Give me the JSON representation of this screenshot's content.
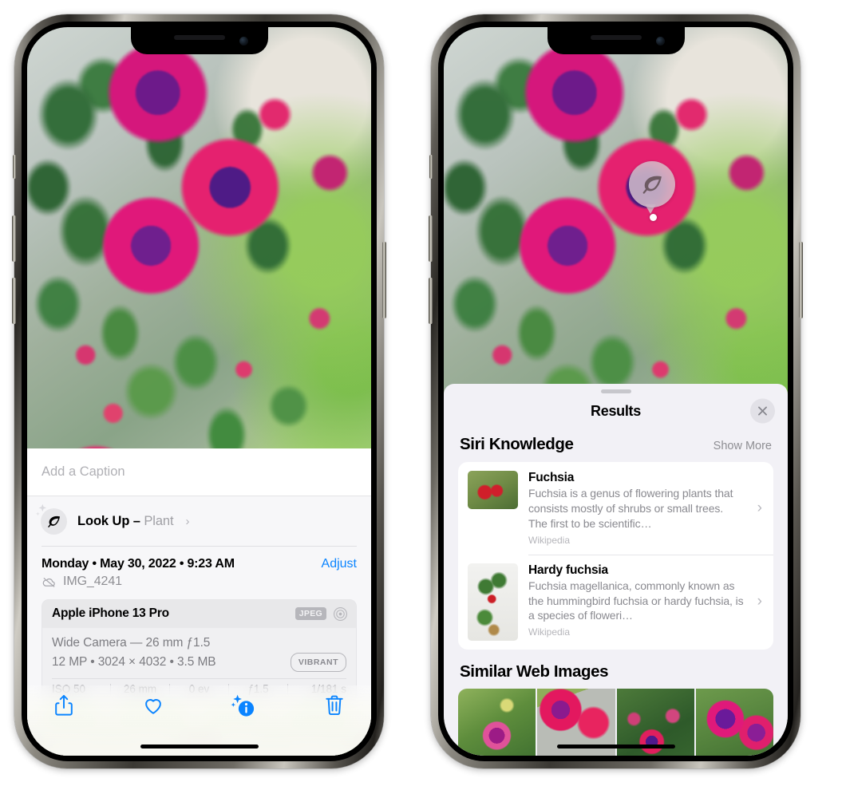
{
  "left_phone": {
    "caption": {
      "placeholder": "Add a Caption",
      "value": ""
    },
    "lookup": {
      "label": "Look Up – ",
      "subject": "Plant",
      "chevron": "›",
      "icon": "leaf-icon",
      "sparkle_icon": "sparkle-icon"
    },
    "date_row": {
      "date": "Monday • May 30, 2022 • 9:23 AM",
      "adjust_label": "Adjust"
    },
    "filename": {
      "name": "IMG_4241",
      "icon": "icloud-slash-icon"
    },
    "exif": {
      "device": "Apple iPhone 13 Pro",
      "format_badge": "JPEG",
      "format_icon": "target-icon",
      "lens_line": "Wide Camera — 26 mm ƒ1.5",
      "size_line": "12 MP • 3024 × 4032 • 3.5 MB",
      "style_badge": "VIBRANT",
      "stats": [
        "ISO 50",
        "26 mm",
        "0 ev",
        "ƒ1.5",
        "1/181 s"
      ]
    },
    "toolbar": {
      "share_label": "share-icon",
      "favorite_label": "heart-icon",
      "info_label": "info-sparkle-icon",
      "delete_label": "trash-icon",
      "accent": "#0a84ff"
    }
  },
  "right_phone": {
    "visual_lookup_badge": {
      "icon": "leaf-icon"
    },
    "sheet": {
      "title": "Results",
      "close_icon": "close-icon",
      "sections": [
        {
          "title": "Siri Knowledge",
          "action": "Show More",
          "items": [
            {
              "name": "Fuchsia",
              "description": "Fuchsia is a genus of flowering plants that consists mostly of shrubs or small trees. The first to be scientific…",
              "source": "Wikipedia",
              "chevron": "›"
            },
            {
              "name": "Hardy fuchsia",
              "description": "Fuchsia magellanica, commonly known as the hummingbird fuchsia or hardy fuchsia, is a species of floweri…",
              "source": "Wikipedia",
              "chevron": "›"
            }
          ]
        },
        {
          "title": "Similar Web Images",
          "thumbnail_count": 4
        }
      ]
    }
  }
}
